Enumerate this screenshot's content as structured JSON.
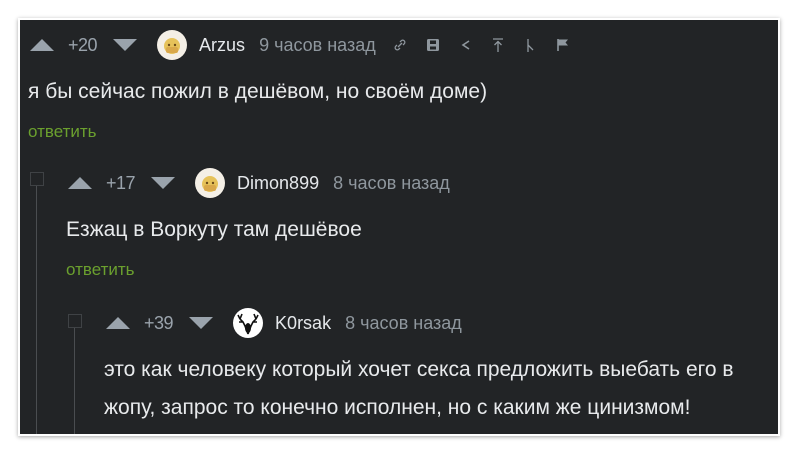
{
  "comments": [
    {
      "score": "+20",
      "author": "Arzus",
      "time": "9 часов назад",
      "text": "я бы сейчас пожил в дешёвом, но своём доме)",
      "reply_label": "ответить"
    },
    {
      "score": "+17",
      "author": "Dimon899",
      "time": "8 часов назад",
      "text": "Езжац в Воркуту там дешёвое",
      "reply_label": "ответить"
    },
    {
      "score": "+39",
      "author": "K0rsak",
      "time": "8 часов назад",
      "text_lines": [
        "это как человеку который хочет секса предложить выебать его в",
        "жопу, запрос то конечно исполнен, но с каким же цинизмом!"
      ]
    }
  ],
  "icons": {
    "toolbar": [
      "link-icon",
      "save-icon",
      "share-icon",
      "scroll-to-top-icon",
      "branch-icon",
      "report-flag-icon"
    ]
  },
  "colors": {
    "background": "#222426",
    "text": "#e8eaec",
    "muted": "#8f979e",
    "reply_link": "#6ba02e"
  }
}
